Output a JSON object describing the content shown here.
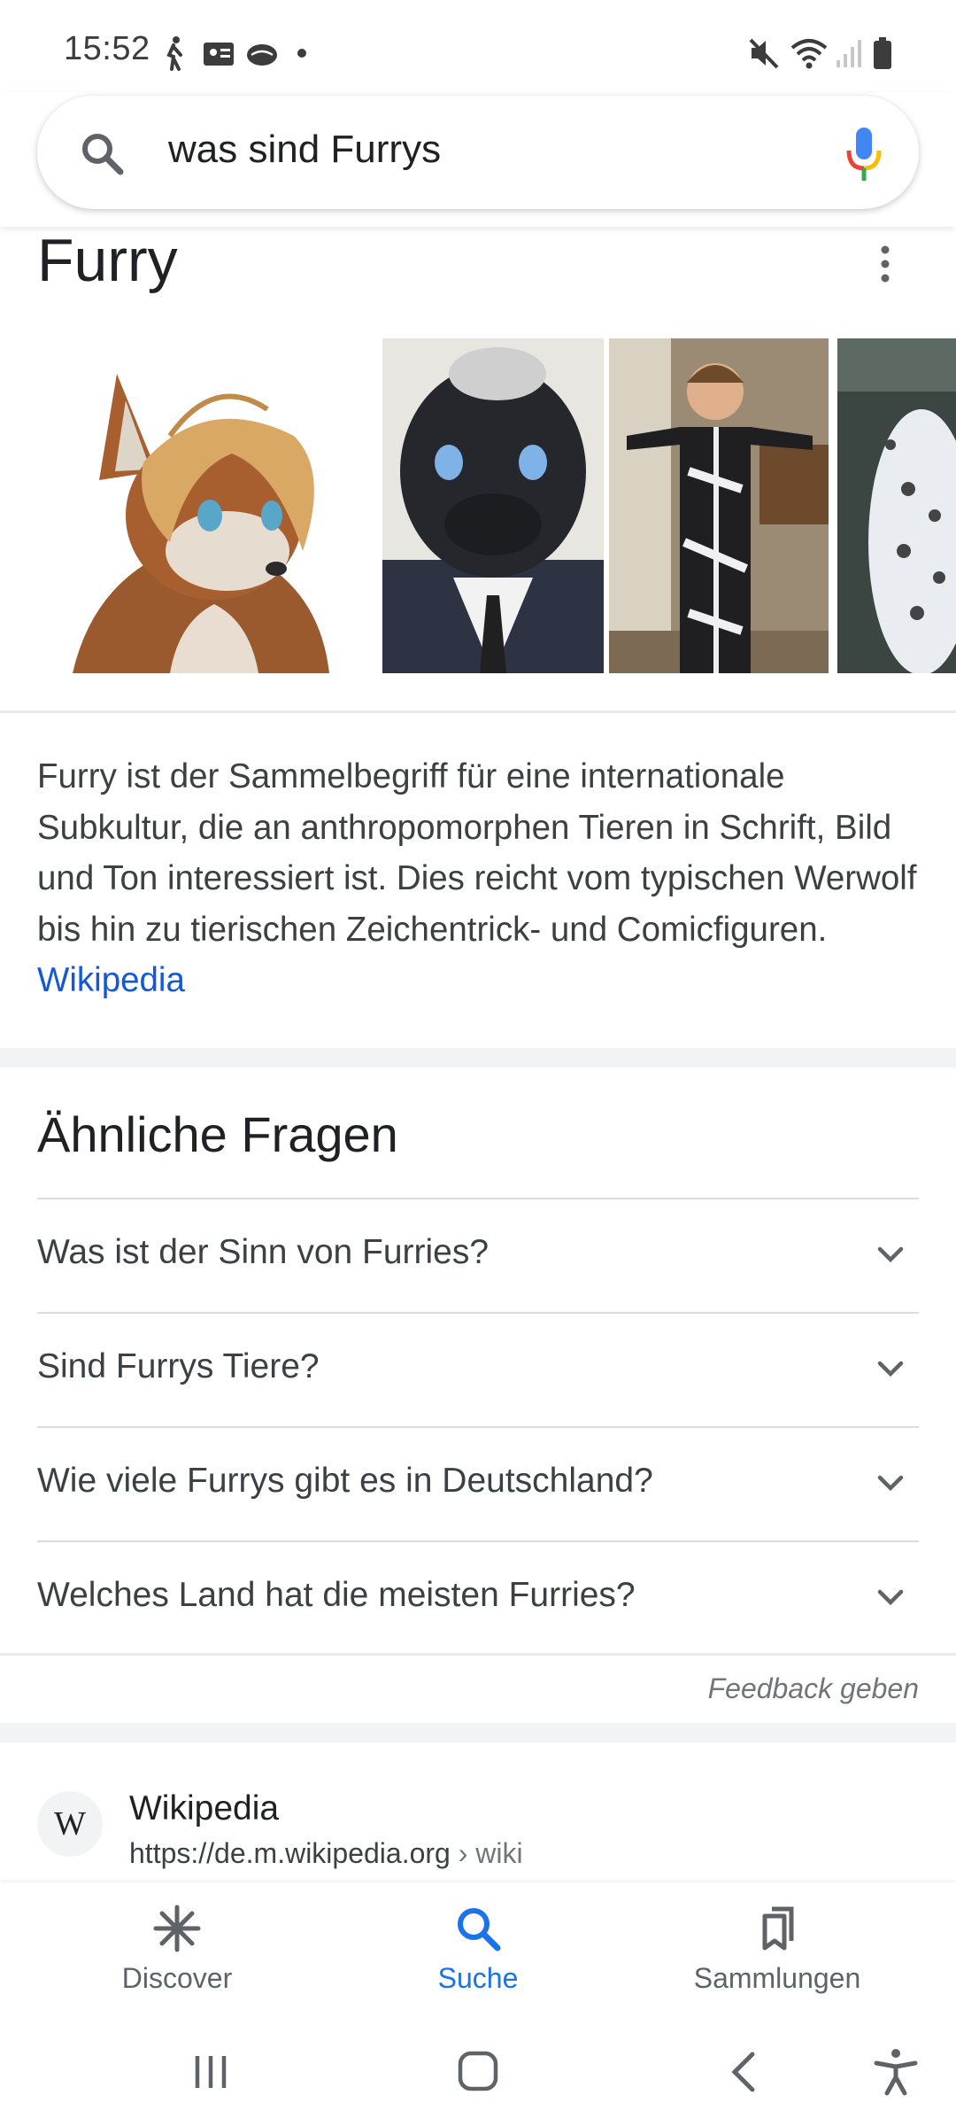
{
  "status_bar": {
    "time": "15:52",
    "left_icons": [
      "walking-icon",
      "contact-card-icon",
      "cloud-icon",
      "dot-icon"
    ],
    "right_icons": [
      "mute-icon",
      "wifi-icon",
      "signal-icon",
      "battery-icon"
    ]
  },
  "search": {
    "query": "was sind Furrys",
    "icon": "search-icon",
    "mic_icon": "mic-icon"
  },
  "knowledge_panel": {
    "title": "Furry",
    "more_icon": "more-vert-icon",
    "images": [
      "furry-fox-drawing",
      "black-fursuit-head",
      "person-in-suit",
      "snow-leopard-fursuit"
    ],
    "description": "Furry ist der Sammelbegriff für eine internationale Subkultur, die an anthropomorphen Tieren in Schrift, Bild und Ton interessiert ist. Dies reicht vom typischen Werwolf bis hin zu tierischen Zeichentrick- und Comicfiguren.",
    "source_link": "Wikipedia"
  },
  "related_questions": {
    "title": "Ähnliche Fragen",
    "items": [
      {
        "question": "Was ist der Sinn von Furries?"
      },
      {
        "question": "Sind Furrys Tiere?"
      },
      {
        "question": "Wie viele Furrys gibt es in Deutschland?"
      },
      {
        "question": "Welches Land hat die meisten Furries?"
      }
    ],
    "feedback": "Feedback geben"
  },
  "result": {
    "logo_letter": "W",
    "site_name": "Wikipedia",
    "url": "https://de.m.wikipedia.org",
    "breadcrumb": " › wiki"
  },
  "bottom_nav": {
    "items": [
      {
        "label": "Discover",
        "icon": "asterisk-icon"
      },
      {
        "label": "Suche",
        "icon": "search-icon",
        "active": true
      },
      {
        "label": "Sammlungen",
        "icon": "bookmarks-icon"
      }
    ]
  },
  "system_nav": [
    "recents-icon",
    "home-icon",
    "back-icon",
    "accessibility-icon"
  ],
  "colors": {
    "accent": "#1a73e8",
    "link": "#1558d6",
    "text": "#202124"
  }
}
